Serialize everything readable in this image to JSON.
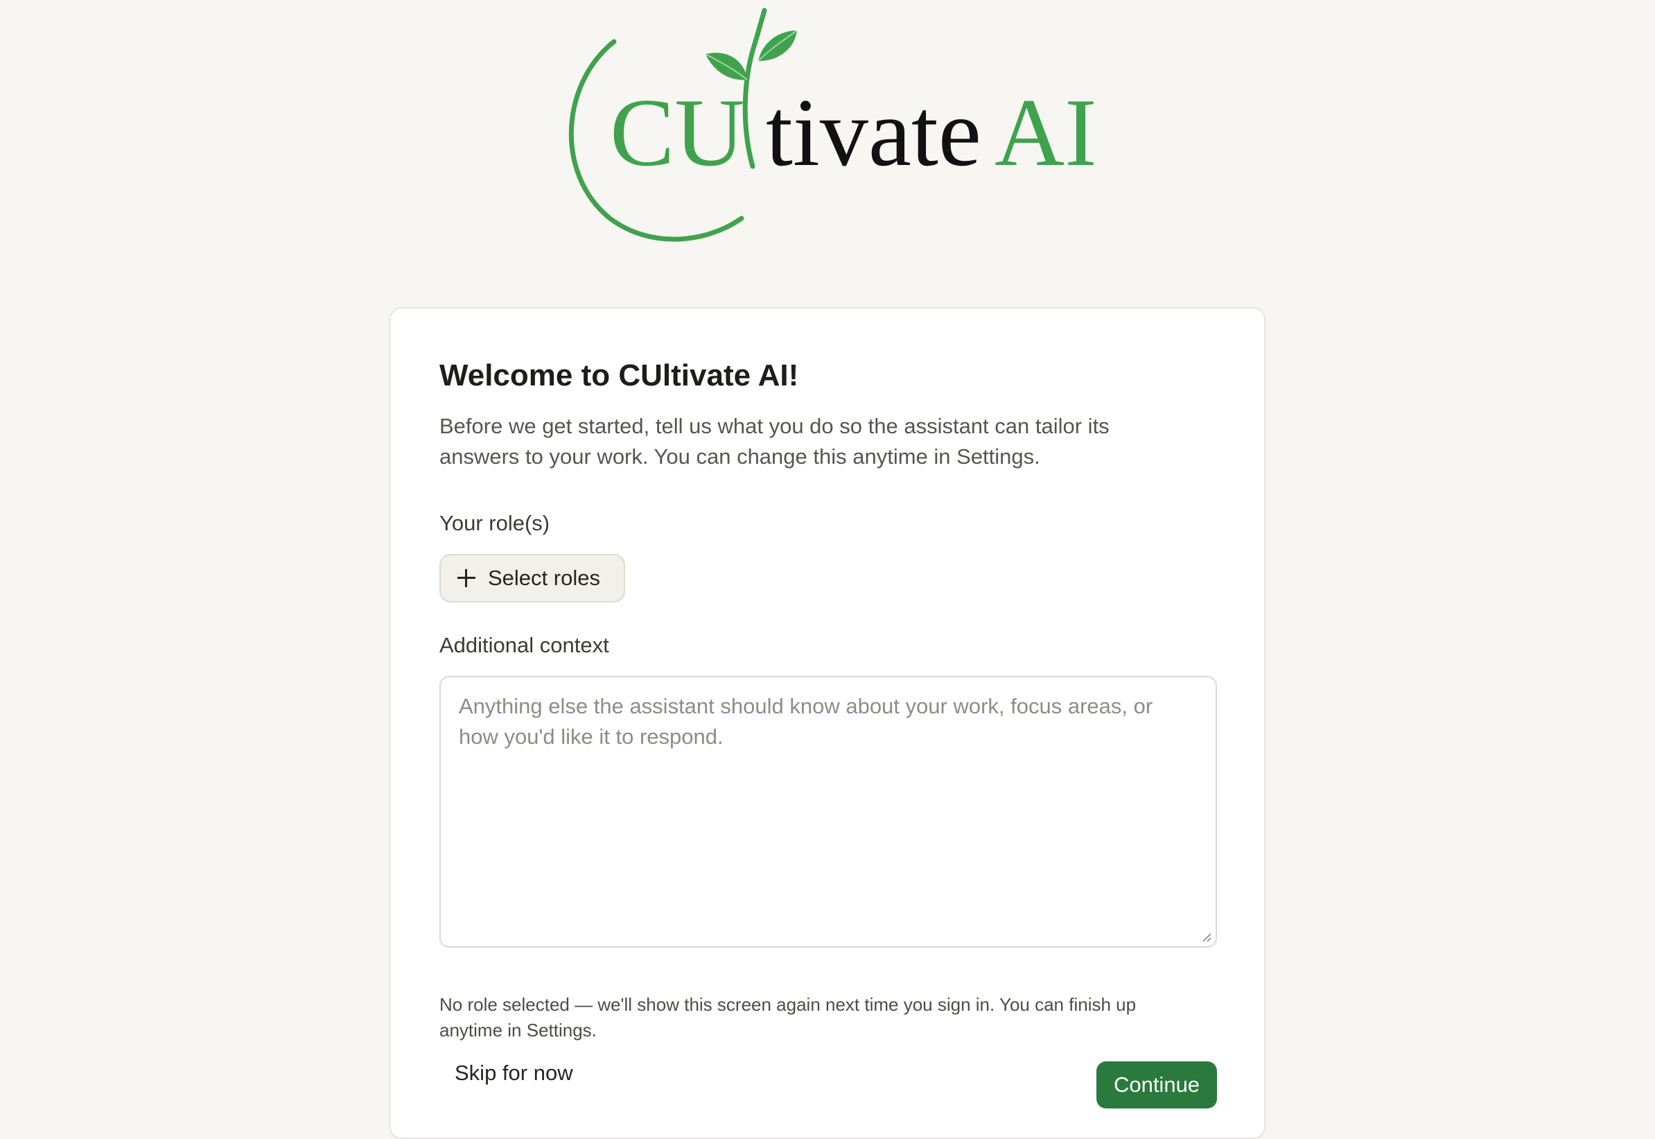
{
  "logo": {
    "text_part1": "CU",
    "text_part2": "tivate",
    "text_part3": "AI",
    "colors": {
      "green": "#3fa34d",
      "black": "#111111"
    }
  },
  "card": {
    "title": "Welcome to CUltivate AI!",
    "intro": "Before we get started, tell us what you do so the assistant can tailor its answers to your work. You can change this anytime in Settings.",
    "roles_label": "Your role(s)",
    "select_roles_label": "Select roles",
    "context_label": "Additional context",
    "context_placeholder": "Anything else the assistant should know about your work, focus areas, or how you'd like it to respond.",
    "context_value": "",
    "note": "No role selected — we'll show this screen again next time you sign in. You can finish up anytime in Settings.",
    "skip_label": "Skip for now",
    "continue_label": "Continue"
  },
  "colors": {
    "accent": "#2a7a3d",
    "background": "#f7f6f2"
  },
  "icons": {
    "plus": "plus-icon",
    "resize": "resize-handle-icon"
  }
}
